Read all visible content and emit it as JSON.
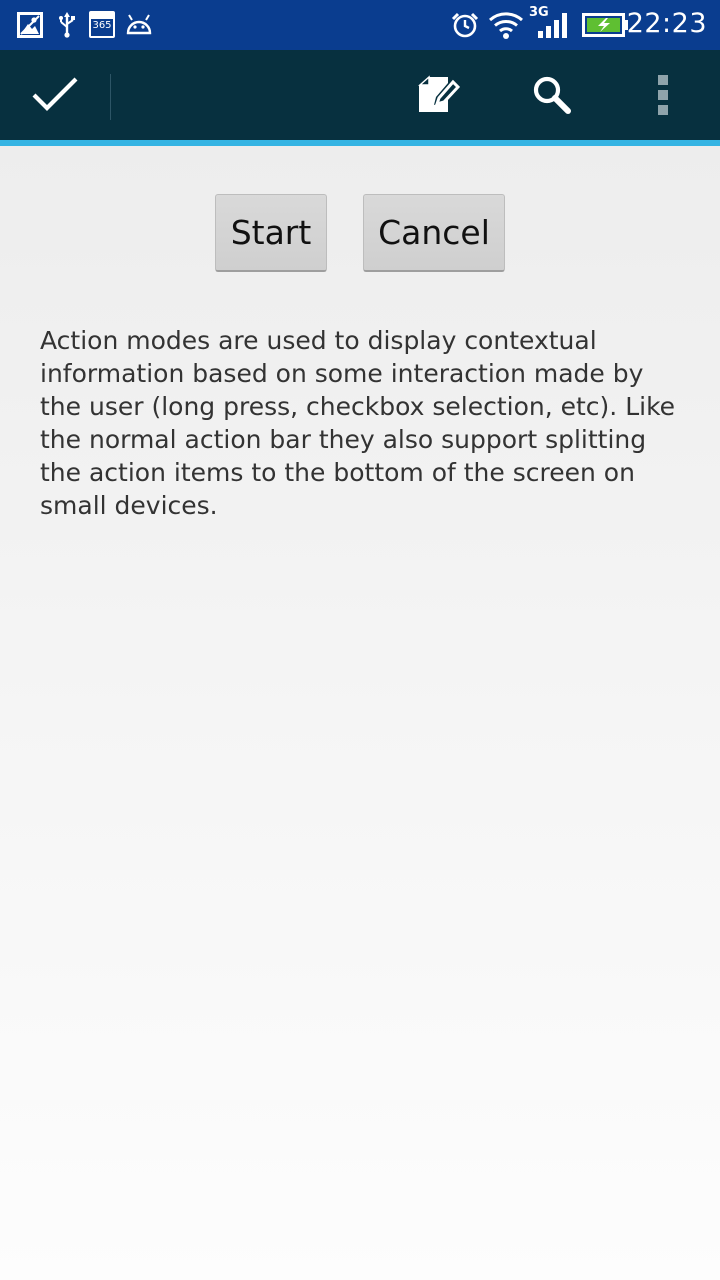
{
  "status_bar": {
    "time": "22:23",
    "network_label": "3G",
    "calendar_label": "365",
    "background_color": "#0a3d8f",
    "left_icons": [
      "gallery-icon",
      "usb-icon",
      "calendar-icon",
      "android-icon"
    ],
    "right_icons": [
      "alarm-icon",
      "wifi-icon",
      "signal-icon",
      "battery-charging-icon"
    ]
  },
  "action_mode": {
    "done_icon": "check-icon",
    "actions": [
      "edit-icon",
      "search-icon",
      "overflow-menu-icon"
    ],
    "background_color": "#07303f",
    "accent_color": "#35b4e3"
  },
  "buttons": {
    "start_label": "Start",
    "cancel_label": "Cancel"
  },
  "description": "Action modes are used to display contextual information based on some interaction made by the user (long press, checkbox selection, etc). Like the normal action bar they also support splitting the action items to the bottom of the screen on small devices."
}
